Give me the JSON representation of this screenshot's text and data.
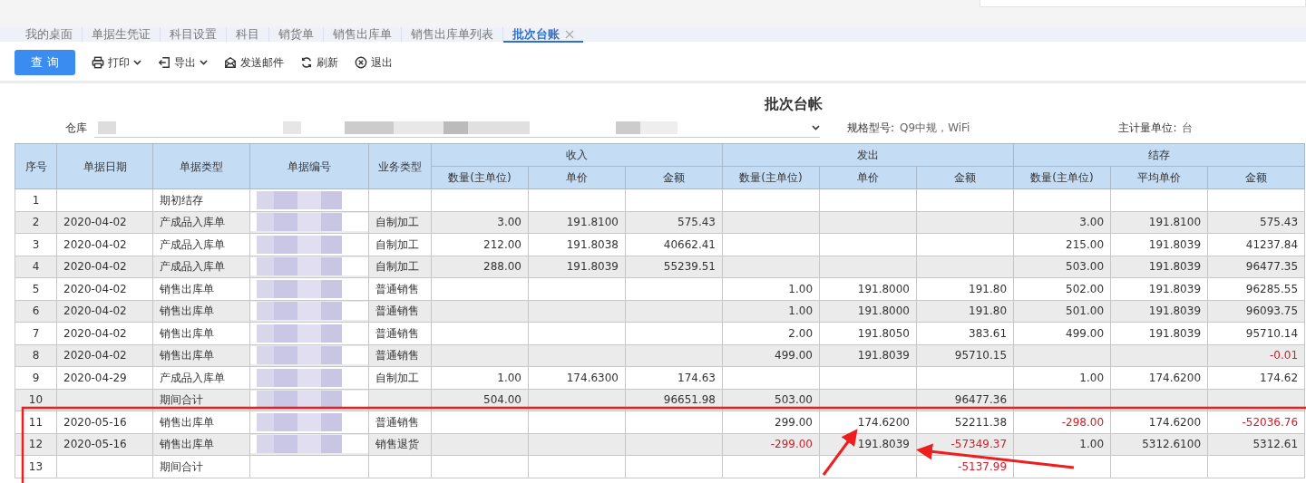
{
  "tabs": [
    {
      "label": "我的桌面",
      "selected": false,
      "closable": false
    },
    {
      "label": "单据生凭证",
      "selected": false,
      "closable": false
    },
    {
      "label": "科目设置",
      "selected": false,
      "closable": false
    },
    {
      "label": "科目",
      "selected": false,
      "closable": false
    },
    {
      "label": "销货单",
      "selected": false,
      "closable": false
    },
    {
      "label": "销售出库单",
      "selected": false,
      "closable": false
    },
    {
      "label": "销售出库单列表",
      "selected": false,
      "closable": false
    },
    {
      "label": "批次台账",
      "selected": true,
      "closable": true
    }
  ],
  "toolbar": [
    {
      "kind": "primary",
      "label": "查 询"
    },
    {
      "kind": "print",
      "label": "打印",
      "dropdown": true
    },
    {
      "kind": "export",
      "label": "导出",
      "dropdown": true
    },
    {
      "kind": "mail",
      "label": "发送邮件",
      "dropdown": false
    },
    {
      "kind": "refresh",
      "label": "刷新",
      "dropdown": false
    },
    {
      "kind": "exit",
      "label": "退出",
      "dropdown": false
    }
  ],
  "report": {
    "title": "批次台帐",
    "filters": {
      "warehouse_label": "仓库",
      "spec_label": "规格型号:",
      "spec_value": "Q9中规，WiFi",
      "unit_label": "主计量单位:",
      "unit_value": "台"
    },
    "table": {
      "fixed_columns": [
        "序号",
        "单据日期",
        "单据类型",
        "单据编号",
        "业务类型"
      ],
      "groups": [
        {
          "label": "收入",
          "columns": [
            "数量(主单位)",
            "单价",
            "金额"
          ]
        },
        {
          "label": "发出",
          "columns": [
            "数量(主单位)",
            "单价",
            "金额"
          ]
        },
        {
          "label": "结存",
          "columns": [
            "数量(主单位)",
            "平均单价",
            "金额"
          ]
        }
      ],
      "rows": [
        {
          "no": "1",
          "type": "期初结存",
          "values": {}
        },
        {
          "no": "2",
          "date": "2020-04-02",
          "type": "产成品入库单",
          "biz": "自制加工",
          "values": {
            "in_qty": {
              "text": "3.00",
              "negative": false
            },
            "in_price": {
              "text": "191.8100",
              "negative": false
            },
            "in_amount": {
              "text": "575.43",
              "negative": false
            },
            "bal_qty": {
              "text": "3.00",
              "negative": false
            },
            "bal_price": {
              "text": "191.8100",
              "negative": false
            },
            "bal_amount": {
              "text": "575.43",
              "negative": false
            }
          }
        },
        {
          "no": "3",
          "date": "2020-04-02",
          "type": "产成品入库单",
          "biz": "自制加工",
          "values": {
            "in_qty": {
              "text": "212.00",
              "negative": false
            },
            "in_price": {
              "text": "191.8038",
              "negative": false
            },
            "in_amount": {
              "text": "40662.41",
              "negative": false
            },
            "bal_qty": {
              "text": "215.00",
              "negative": false
            },
            "bal_price": {
              "text": "191.8039",
              "negative": false
            },
            "bal_amount": {
              "text": "41237.84",
              "negative": false
            }
          }
        },
        {
          "no": "4",
          "date": "2020-04-02",
          "type": "产成品入库单",
          "biz": "自制加工",
          "values": {
            "in_qty": {
              "text": "288.00",
              "negative": false
            },
            "in_price": {
              "text": "191.8039",
              "negative": false
            },
            "in_amount": {
              "text": "55239.51",
              "negative": false
            },
            "bal_qty": {
              "text": "503.00",
              "negative": false
            },
            "bal_price": {
              "text": "191.8039",
              "negative": false
            },
            "bal_amount": {
              "text": "96477.35",
              "negative": false
            }
          }
        },
        {
          "no": "5",
          "date": "2020-04-02",
          "type": "销售出库单",
          "biz": "普通销售",
          "values": {
            "out_qty": {
              "text": "1.00",
              "negative": false
            },
            "out_price": {
              "text": "191.8000",
              "negative": false
            },
            "out_amount": {
              "text": "191.80",
              "negative": false
            },
            "bal_qty": {
              "text": "502.00",
              "negative": false
            },
            "bal_price": {
              "text": "191.8039",
              "negative": false
            },
            "bal_amount": {
              "text": "96285.55",
              "negative": false
            }
          }
        },
        {
          "no": "6",
          "date": "2020-04-02",
          "type": "销售出库单",
          "biz": "普通销售",
          "values": {
            "out_qty": {
              "text": "1.00",
              "negative": false
            },
            "out_price": {
              "text": "191.8000",
              "negative": false
            },
            "out_amount": {
              "text": "191.80",
              "negative": false
            },
            "bal_qty": {
              "text": "501.00",
              "negative": false
            },
            "bal_price": {
              "text": "191.8039",
              "negative": false
            },
            "bal_amount": {
              "text": "96093.75",
              "negative": false
            }
          }
        },
        {
          "no": "7",
          "date": "2020-04-02",
          "type": "销售出库单",
          "biz": "普通销售",
          "values": {
            "out_qty": {
              "text": "2.00",
              "negative": false
            },
            "out_price": {
              "text": "191.8050",
              "negative": false
            },
            "out_amount": {
              "text": "383.61",
              "negative": false
            },
            "bal_qty": {
              "text": "499.00",
              "negative": false
            },
            "bal_price": {
              "text": "191.8039",
              "negative": false
            },
            "bal_amount": {
              "text": "95710.14",
              "negative": false
            }
          }
        },
        {
          "no": "8",
          "date": "2020-04-02",
          "type": "销售出库单",
          "biz": "普通销售",
          "values": {
            "out_qty": {
              "text": "499.00",
              "negative": false
            },
            "out_price": {
              "text": "191.8039",
              "negative": false
            },
            "out_amount": {
              "text": "95710.15",
              "negative": false
            },
            "bal_amount": {
              "text": "-0.01",
              "negative": true
            }
          }
        },
        {
          "no": "9",
          "date": "2020-04-29",
          "type": "产成品入库单",
          "biz": "自制加工",
          "values": {
            "in_qty": {
              "text": "1.00",
              "negative": false
            },
            "in_price": {
              "text": "174.6300",
              "negative": false
            },
            "in_amount": {
              "text": "174.63",
              "negative": false
            },
            "bal_qty": {
              "text": "1.00",
              "negative": false
            },
            "bal_price": {
              "text": "174.6200",
              "negative": false
            },
            "bal_amount": {
              "text": "174.62",
              "negative": false
            }
          }
        },
        {
          "no": "10",
          "type": "期间合计",
          "values": {
            "in_qty": {
              "text": "504.00",
              "negative": false
            },
            "in_amount": {
              "text": "96651.98",
              "negative": false
            },
            "out_qty": {
              "text": "503.00",
              "negative": false
            },
            "out_amount": {
              "text": "96477.36",
              "negative": false
            }
          }
        },
        {
          "no": "11",
          "date": "2020-05-16",
          "type": "销售出库单",
          "biz": "普通销售",
          "values": {
            "out_qty": {
              "text": "299.00",
              "negative": false
            },
            "out_price": {
              "text": "174.6200",
              "negative": false
            },
            "out_amount": {
              "text": "52211.38",
              "negative": false
            },
            "bal_qty": {
              "text": "-298.00",
              "negative": true
            },
            "bal_price": {
              "text": "174.6200",
              "negative": false
            },
            "bal_amount": {
              "text": "-52036.76",
              "negative": true
            }
          }
        },
        {
          "no": "12",
          "date": "2020-05-16",
          "type": "销售出库单",
          "biz": "销售退货",
          "values": {
            "out_qty": {
              "text": "-299.00",
              "negative": true
            },
            "out_price": {
              "text": "191.8039",
              "negative": false
            },
            "out_amount": {
              "text": "-57349.37",
              "negative": true
            },
            "bal_qty": {
              "text": "1.00",
              "negative": false
            },
            "bal_price": {
              "text": "5312.6100",
              "negative": false
            },
            "bal_amount": {
              "text": "5312.61",
              "negative": false
            }
          }
        },
        {
          "no": "13",
          "type": "期间合计",
          "values": {
            "out_amount": {
              "text": "-5137.99",
              "negative": true
            }
          }
        }
      ]
    }
  }
}
